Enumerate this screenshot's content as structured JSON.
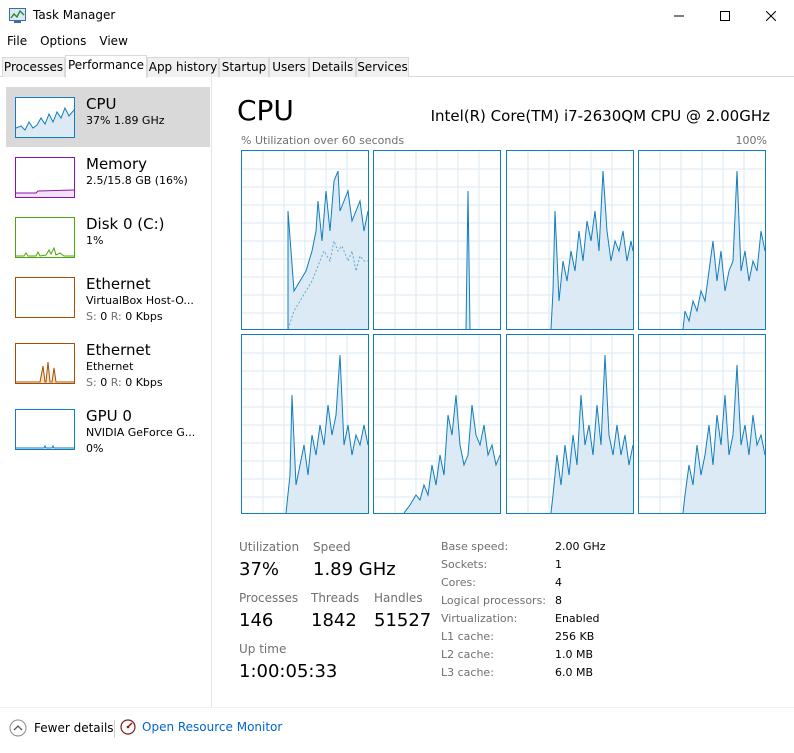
{
  "window": {
    "title": "Task Manager"
  },
  "menu": [
    "File",
    "Options",
    "View"
  ],
  "tabs": [
    "Processes",
    "Performance",
    "App history",
    "Startup",
    "Users",
    "Details",
    "Services"
  ],
  "sidebar": [
    {
      "name": "CPU",
      "sub": "37%  1.89 GHz",
      "sub2": "",
      "color": "#117dbb"
    },
    {
      "name": "Memory",
      "sub": "2.5/15.8 GB (16%)",
      "sub2": "",
      "color": "#8b12ae"
    },
    {
      "name": "Disk 0 (C:)",
      "sub": "1%",
      "sub2": "",
      "color": "#4da60c"
    },
    {
      "name": "Ethernet",
      "sub": "VirtualBox Host-O...",
      "sub2_label_s": "S:",
      "sub2_s": "0",
      "sub2_label_r": "R:",
      "sub2_r": "0 Kbps",
      "color": "#a74f01"
    },
    {
      "name": "Ethernet",
      "sub": "Ethernet",
      "sub2_label_s": "S:",
      "sub2_s": "0",
      "sub2_label_r": "R:",
      "sub2_r": "0 Kbps",
      "color": "#a74f01"
    },
    {
      "name": "GPU 0",
      "sub": "NVIDIA GeForce G...",
      "sub2": "0%",
      "color": "#117dbb"
    }
  ],
  "main": {
    "title": "CPU",
    "cpu_name": "Intel(R) Core(TM) i7-2630QM CPU @ 2.00GHz",
    "util_label": "% Utilization over 60 seconds",
    "util_max": "100%"
  },
  "stats": {
    "utilization_label": "Utilization",
    "utilization": "37%",
    "speed_label": "Speed",
    "speed": "1.89 GHz",
    "processes_label": "Processes",
    "processes": "146",
    "threads_label": "Threads",
    "threads": "1842",
    "handles_label": "Handles",
    "handles": "51527",
    "uptime_label": "Up time",
    "uptime": "1:00:05:33"
  },
  "details": [
    {
      "label": "Base speed:",
      "value": "2.00 GHz"
    },
    {
      "label": "Sockets:",
      "value": "1"
    },
    {
      "label": "Cores:",
      "value": "4"
    },
    {
      "label": "Logical processors:",
      "value": "8"
    },
    {
      "label": "Virtualization:",
      "value": "Enabled"
    },
    {
      "label": "L1 cache:",
      "value": "256 KB"
    },
    {
      "label": "L2 cache:",
      "value": "1.0 MB"
    },
    {
      "label": "L3 cache:",
      "value": "6.0 MB"
    }
  ],
  "footer": {
    "fewer_details": "Fewer details",
    "open_resource_monitor": "Open Resource Monitor"
  },
  "colors": {
    "accent": "#117dbb",
    "selected_bg": "#d9d9d9",
    "link": "#0066cc"
  },
  "icons": [
    "task-manager-icon",
    "minimize-icon",
    "maximize-icon",
    "close-icon",
    "chevron-up-icon",
    "resource-monitor-icon"
  ]
}
